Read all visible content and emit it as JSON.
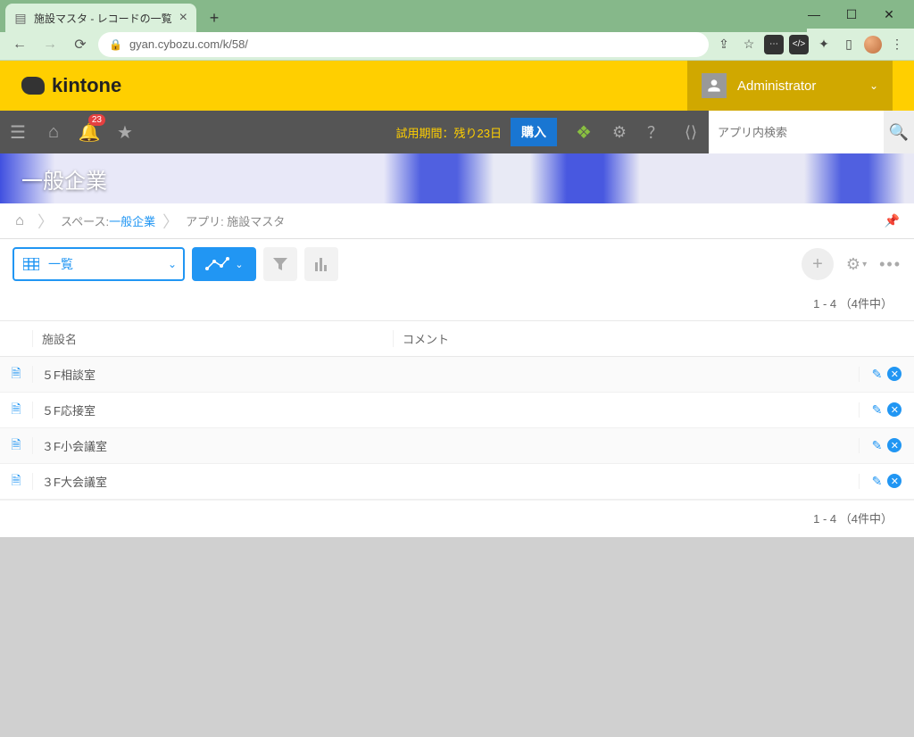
{
  "browser": {
    "tab_title": "施設マスタ - レコードの一覧",
    "url": "gyan.cybozu.com/k/58/"
  },
  "header": {
    "logo_text": "kintone",
    "user_name": "Administrator",
    "notif_count": "23",
    "trial_text": "試用期間：残り23日",
    "buy_label": "購入",
    "search_placeholder": "アプリ内検索"
  },
  "hero": {
    "title": "一般企業"
  },
  "breadcrumb": {
    "space_label": "スペース: ",
    "space_link": "一般企業",
    "app_label": "アプリ: 施設マスタ"
  },
  "toolbar": {
    "view_label": "一覧"
  },
  "pagination": {
    "text": "1 - 4 （4件中）"
  },
  "table": {
    "headers": {
      "name": "施設名",
      "comment": "コメント"
    },
    "rows": [
      {
        "name": "５F相談室",
        "comment": ""
      },
      {
        "name": "５F応接室",
        "comment": ""
      },
      {
        "name": "３F小会議室",
        "comment": ""
      },
      {
        "name": "３F大会議室",
        "comment": ""
      }
    ]
  }
}
